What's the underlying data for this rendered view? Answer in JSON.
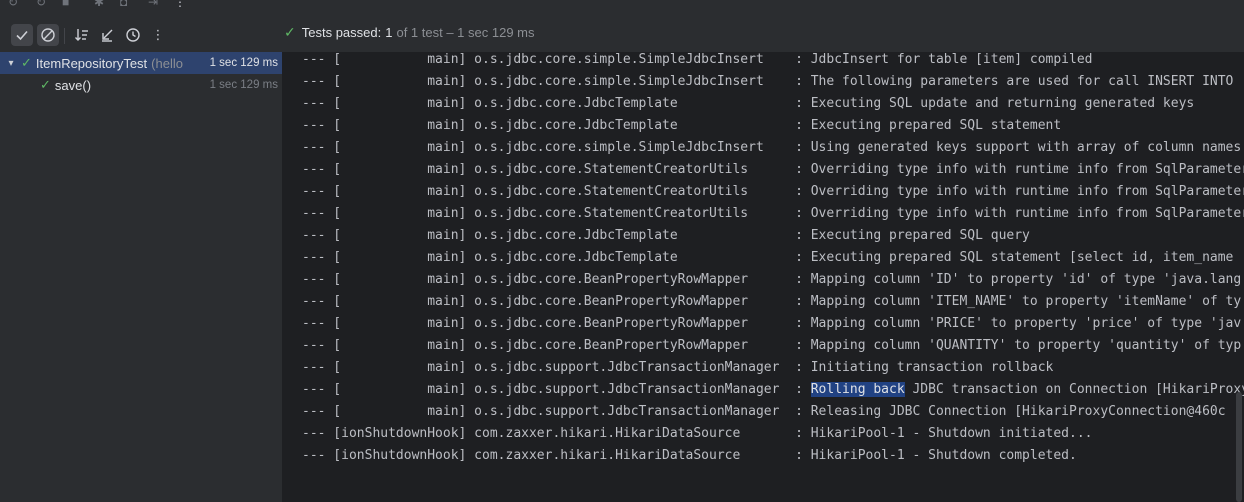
{
  "status": {
    "label": "Tests passed:",
    "passed": "1",
    "rest": "of 1 test – 1 sec 129 ms"
  },
  "tree": {
    "root": {
      "label": "ItemRepositoryTest",
      "hint": "(hello",
      "time": "1 sec 129 ms"
    },
    "child": {
      "label": "save()",
      "time": "1 sec 129 ms"
    }
  },
  "console": {
    "lines": [
      {
        "pre": "--- [           main] o.s.jdbc.core.simple.SimpleJdbcInsert    : JdbcInsert for table [item] compiled",
        "hl": "",
        "post": ""
      },
      {
        "pre": "--- [           main] o.s.jdbc.core.simple.SimpleJdbcInsert    : The following parameters are used for call INSERT INTO",
        "hl": "",
        "post": ""
      },
      {
        "pre": "--- [           main] o.s.jdbc.core.JdbcTemplate               : Executing SQL update and returning generated keys",
        "hl": "",
        "post": ""
      },
      {
        "pre": "--- [           main] o.s.jdbc.core.JdbcTemplate               : Executing prepared SQL statement",
        "hl": "",
        "post": ""
      },
      {
        "pre": "--- [           main] o.s.jdbc.core.simple.SimpleJdbcInsert    : Using generated keys support with array of column names",
        "hl": "",
        "post": ""
      },
      {
        "pre": "--- [           main] o.s.jdbc.core.StatementCreatorUtils      : Overriding type info with runtime info from SqlParameterValue",
        "hl": "",
        "post": ""
      },
      {
        "pre": "--- [           main] o.s.jdbc.core.StatementCreatorUtils      : Overriding type info with runtime info from SqlParameterValue",
        "hl": "",
        "post": ""
      },
      {
        "pre": "--- [           main] o.s.jdbc.core.StatementCreatorUtils      : Overriding type info with runtime info from SqlParameterValue",
        "hl": "",
        "post": ""
      },
      {
        "pre": "--- [           main] o.s.jdbc.core.JdbcTemplate               : Executing prepared SQL query",
        "hl": "",
        "post": ""
      },
      {
        "pre": "--- [           main] o.s.jdbc.core.JdbcTemplate               : Executing prepared SQL statement [select id, item_name",
        "hl": "",
        "post": ""
      },
      {
        "pre": "--- [           main] o.s.jdbc.core.BeanPropertyRowMapper      : Mapping column 'ID' to property 'id' of type 'java.lang",
        "hl": "",
        "post": ""
      },
      {
        "pre": "--- [           main] o.s.jdbc.core.BeanPropertyRowMapper      : Mapping column 'ITEM_NAME' to property 'itemName' of ty",
        "hl": "",
        "post": ""
      },
      {
        "pre": "--- [           main] o.s.jdbc.core.BeanPropertyRowMapper      : Mapping column 'PRICE' to property 'price' of type 'jav",
        "hl": "",
        "post": ""
      },
      {
        "pre": "--- [           main] o.s.jdbc.core.BeanPropertyRowMapper      : Mapping column 'QUANTITY' to property 'quantity' of typ",
        "hl": "",
        "post": ""
      },
      {
        "pre": "--- [           main] o.s.jdbc.support.JdbcTransactionManager  : Initiating transaction rollback",
        "hl": "",
        "post": ""
      },
      {
        "pre": "--- [           main] o.s.jdbc.support.JdbcTransactionManager  : ",
        "hl": "Rolling back",
        "post": " JDBC transaction on Connection [HikariProxy"
      },
      {
        "pre": "--- [           main] o.s.jdbc.support.JdbcTransactionManager  : Releasing JDBC Connection [HikariProxyConnection@460c",
        "hl": "",
        "post": ""
      },
      {
        "pre": "--- [ionShutdownHook] com.zaxxer.hikari.HikariDataSource       : HikariPool-1 - Shutdown initiated...",
        "hl": "",
        "post": ""
      },
      {
        "pre": "--- [ionShutdownHook] com.zaxxer.hikari.HikariDataSource       : HikariPool-1 - Shutdown completed.",
        "hl": "",
        "post": ""
      }
    ]
  },
  "colors": {
    "pass": "#5fb865",
    "selection": "#2e436e",
    "highlight": "#214283"
  }
}
